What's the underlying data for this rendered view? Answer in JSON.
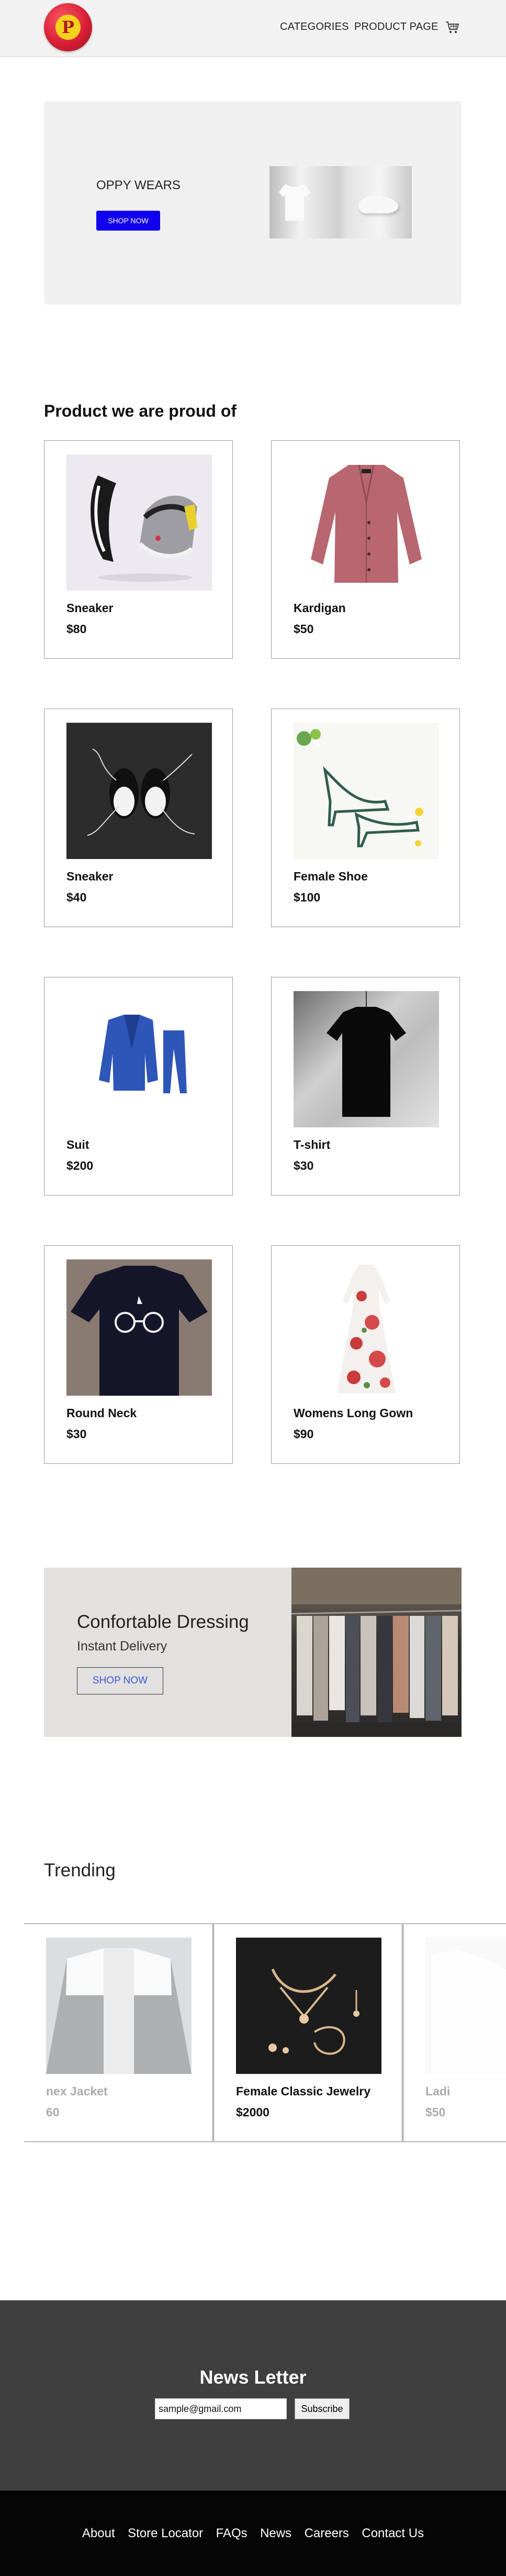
{
  "header": {
    "logo_letter": "P",
    "nav": [
      "CATEGORIES",
      "PRODUCT PAGE"
    ],
    "cart_icon": "cart-icon"
  },
  "hero": {
    "title": "OPPY WEARS",
    "button": "SHOP NOW"
  },
  "products": {
    "heading": "Product we are proud of",
    "items": [
      {
        "name": "Sneaker",
        "price": "$80"
      },
      {
        "name": "Kardigan",
        "price": "$50"
      },
      {
        "name": "Sneaker",
        "price": "$40"
      },
      {
        "name": "Female Shoe",
        "price": "$100"
      },
      {
        "name": "Suit",
        "price": "$200"
      },
      {
        "name": "T-shirt",
        "price": "$30"
      },
      {
        "name": "Round Neck",
        "price": "$30"
      },
      {
        "name": "Womens Long Gown",
        "price": "$90"
      }
    ]
  },
  "banner": {
    "title": "Confortable Dressing",
    "subtitle": "Instant Delivery",
    "button": "SHOP NOW"
  },
  "trending": {
    "heading": "Trending",
    "items": [
      {
        "name": "nex Jacket",
        "price": "60"
      },
      {
        "name": "Female Classic Jewelry",
        "price": "$2000"
      },
      {
        "name": "Ladi",
        "price": "$50"
      }
    ]
  },
  "newsletter": {
    "title": "News Letter",
    "email_value": "sample@gmail.com",
    "button": "Subscribe"
  },
  "footer": {
    "links": [
      "About",
      "Store Locator",
      "FAQs",
      "News",
      "Careers",
      "Contact Us"
    ]
  }
}
